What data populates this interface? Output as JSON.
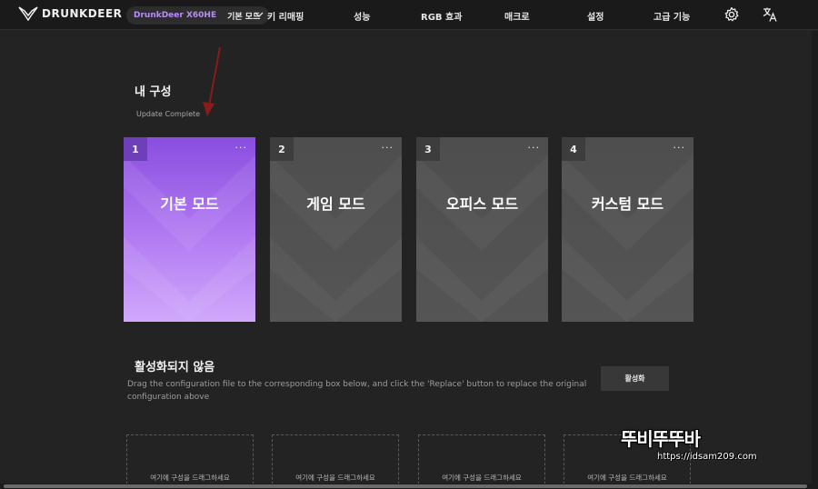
{
  "header": {
    "logo_text": "DRUNKDEER",
    "device_name": "DrunkDeer X60HE",
    "device_mode": "기본 모드",
    "nav": [
      "키 리매핑",
      "성능",
      "RGB 효과",
      "매크로",
      "설정",
      "고급 기능"
    ],
    "icons": [
      "settings-icon",
      "translate-icon"
    ]
  },
  "my_configs": {
    "title": "내 구성",
    "status": "Update Complete",
    "cards": [
      {
        "num": "1",
        "name": "기본 모드",
        "menu": "···",
        "active": true
      },
      {
        "num": "2",
        "name": "게임 모드",
        "menu": "···",
        "active": false
      },
      {
        "num": "3",
        "name": "오피스 모드",
        "menu": "···",
        "active": false
      },
      {
        "num": "4",
        "name": "커스텀 모드",
        "menu": "···",
        "active": false
      }
    ]
  },
  "inactive": {
    "title": "활성화되지 않음",
    "description": "Drag the configuration file to the corresponding box below, and click the 'Replace' button to replace the original configuration above",
    "activate_label": "활성화",
    "drop_label": "여기에 구성을 드래그하세요",
    "drop_boxes": 4
  },
  "watermark": {
    "main": "뚜비뚜뚜바",
    "sub": "https://idsam209.com"
  },
  "colors": {
    "accent": "#b98df7",
    "active_card_top": "#8a4ee0",
    "active_card_bottom": "#cfa8fb",
    "card": "#515151",
    "background": "#232323",
    "arrow": "#8b1a1a"
  }
}
